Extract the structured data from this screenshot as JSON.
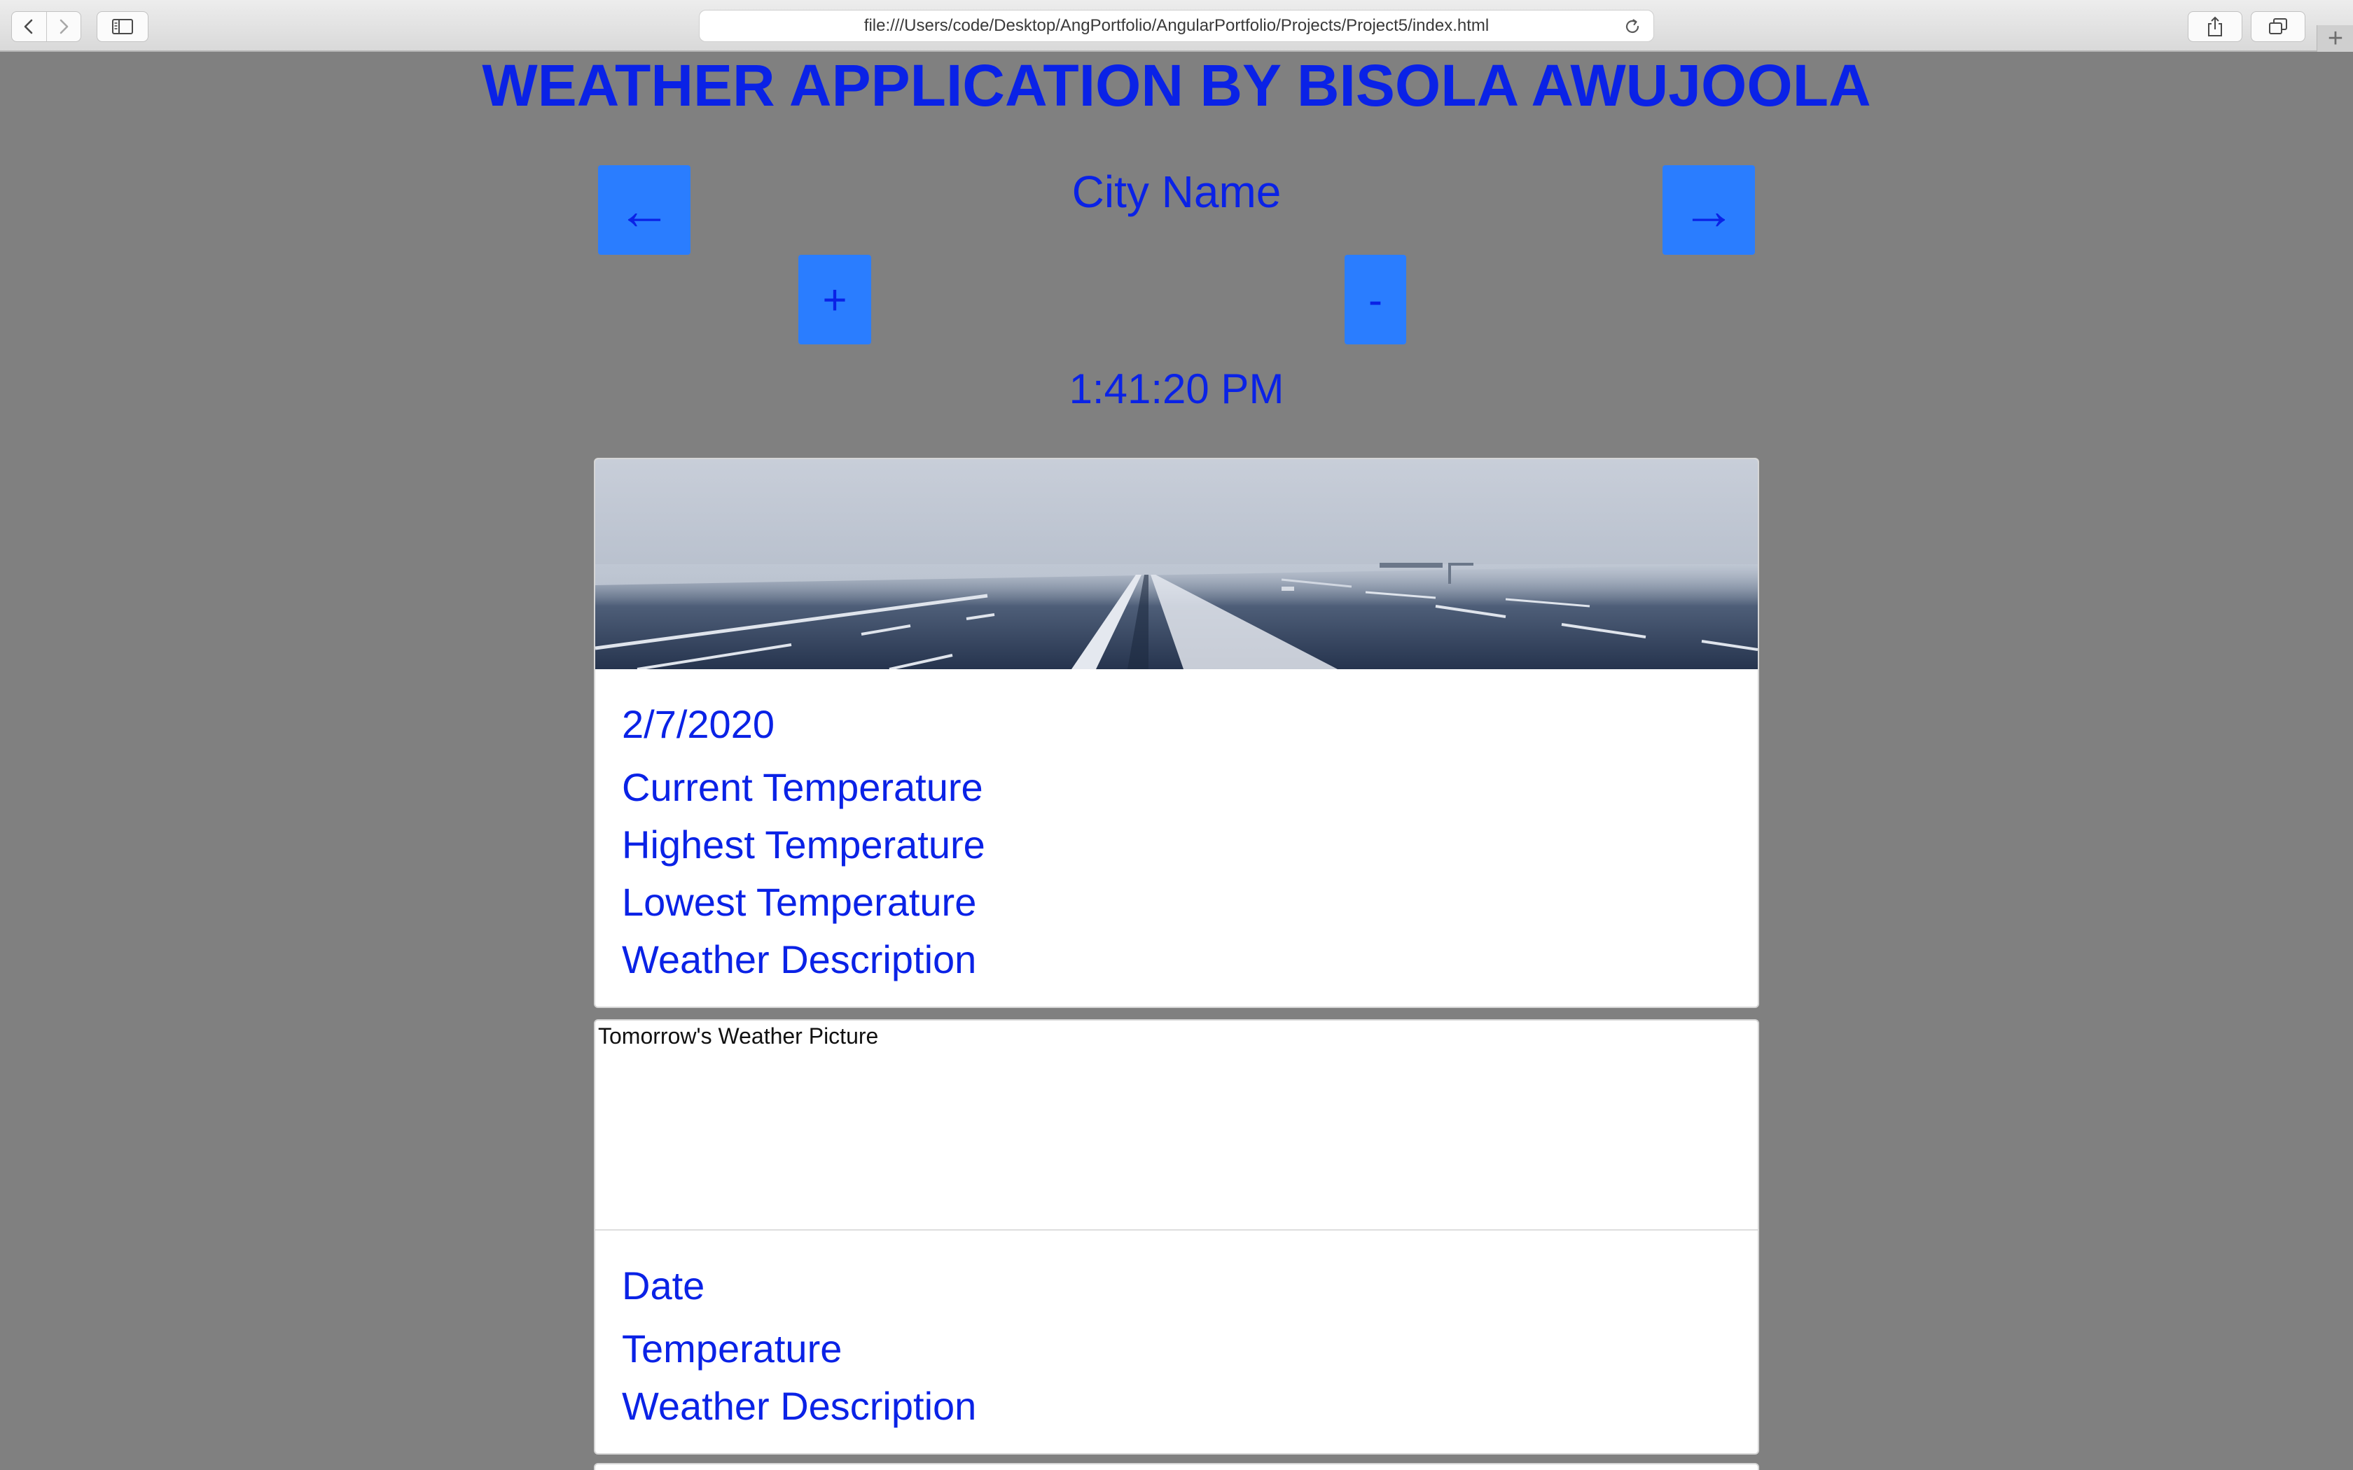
{
  "browser": {
    "url": "file:///Users/code/Desktop/AngPortfolio/AngularPortfolio/Projects/Project5/index.html",
    "icons": {
      "back": "chevron-left-icon",
      "forward": "chevron-right-icon",
      "sidebar": "sidebar-icon",
      "reload": "reload-icon",
      "share": "share-icon",
      "tabs": "tabs-overview-icon",
      "new_tab": "plus-icon"
    },
    "new_tab_label": "+"
  },
  "page": {
    "title": "WEATHER APPLICATION BY BISOLA AWUJOOLA",
    "colors": {
      "background": "#808080",
      "text": "#0a22e6",
      "button": "#2a7dff"
    },
    "prev_label": "←",
    "next_label": "→",
    "city_name": "City Name",
    "plus_label": "+",
    "minus_label": "-",
    "time": "1:41:20 PM"
  },
  "today": {
    "image": "foggy-highway-photo",
    "date": "2/7/2020",
    "current_temperature": "Current Temperature",
    "highest_temperature": "Highest Temperature",
    "lowest_temperature": "Lowest Temperature",
    "weather_description": "Weather Description"
  },
  "tomorrow": {
    "image_alt": "Tomorrow's Weather Picture",
    "date": "Date",
    "temperature": "Temperature",
    "weather_description": "Weather Description"
  }
}
